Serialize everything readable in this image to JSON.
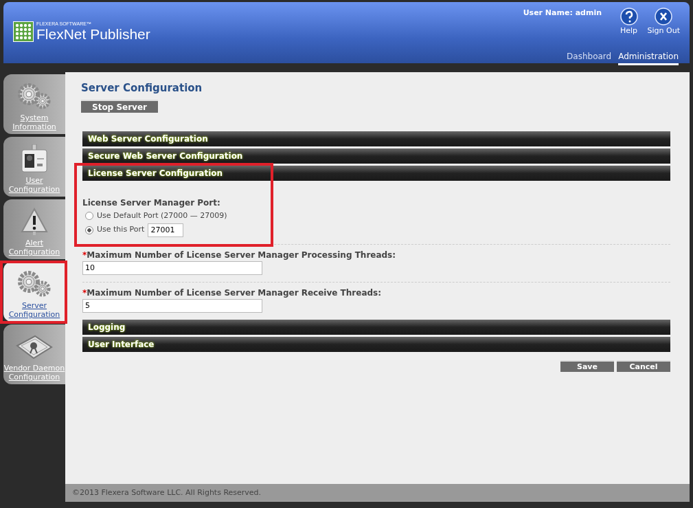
{
  "header": {
    "brand_small": "FLEXERA SOFTWARE™",
    "brand": "FlexNet Publisher",
    "user_label": "User Name: admin",
    "actions": [
      {
        "label": "Help"
      },
      {
        "label": "Sign Out"
      }
    ],
    "tabs": [
      {
        "label": "Dashboard",
        "selected": false
      },
      {
        "label": "Administration",
        "selected": true
      }
    ]
  },
  "sidebar": {
    "items": [
      {
        "label": "System Information",
        "selected": false,
        "highlighted": false
      },
      {
        "label": "User Configuration",
        "selected": false,
        "highlighted": false
      },
      {
        "label": "Alert Configuration",
        "selected": false,
        "highlighted": false
      },
      {
        "label": "Server Configuration",
        "selected": true,
        "highlighted": true
      },
      {
        "label": "Vendor Daemon Configuration",
        "selected": false,
        "highlighted": false
      }
    ]
  },
  "page_title": "Server Configuration",
  "stop_button": "Stop Server",
  "sections": [
    {
      "title": "Web Server Configuration",
      "expanded": false,
      "highlighted": false
    },
    {
      "title": "Secure Web Server Configuration",
      "expanded": false,
      "highlighted": false
    },
    {
      "title": "License Server Configuration",
      "expanded": true,
      "highlighted": true,
      "fields": [
        {
          "kind": "radio_group",
          "label": "License Server Manager Port:",
          "options": [
            {
              "label": "Use Default Port (27000 — 27009)",
              "selected": false
            },
            {
              "label": "Use this Port",
              "selected": true,
              "value": "27001"
            }
          ]
        },
        {
          "kind": "text",
          "required_mark": "*",
          "label": "Maximum Number of License Server Manager Processing Threads:",
          "value": "10"
        },
        {
          "kind": "text",
          "required_mark": "*",
          "label": "Maximum Number of License Server Manager Receive Threads:",
          "value": "5"
        }
      ]
    },
    {
      "title": "Logging",
      "expanded": false,
      "highlighted": false
    },
    {
      "title": "User Interface",
      "expanded": false,
      "highlighted": false
    }
  ],
  "buttons": [
    "Save",
    "Cancel"
  ],
  "footer": "©2013 Flexera Software LLC. All Rights Reserved."
}
